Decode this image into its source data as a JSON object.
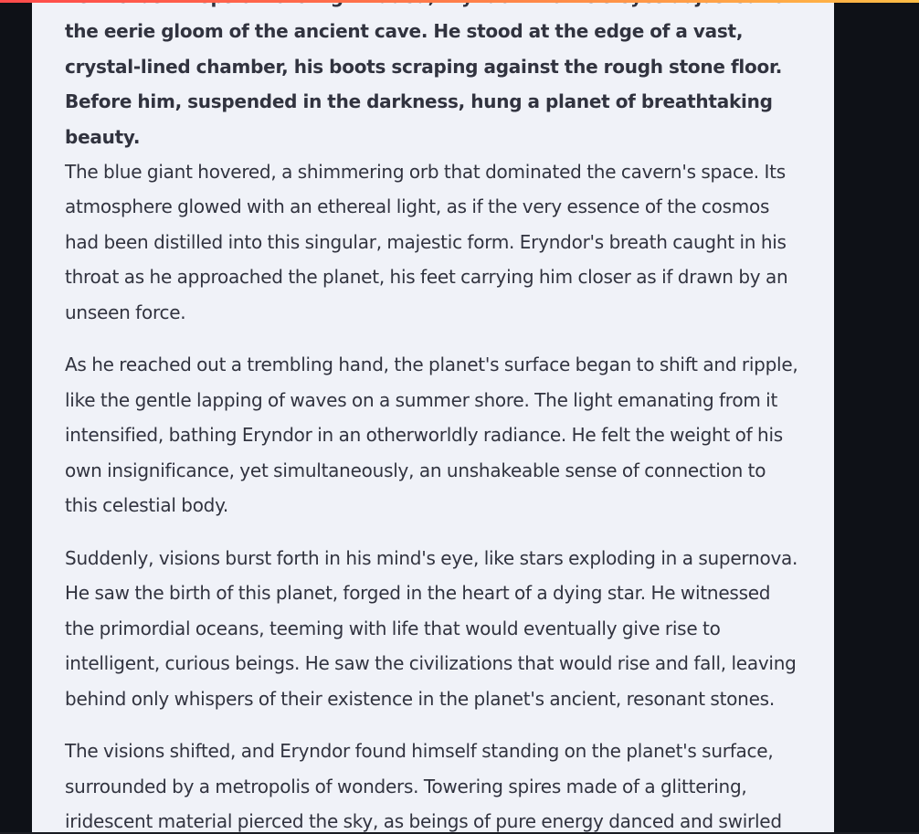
{
  "story": {
    "paragraphs": [
      {
        "style": "bold",
        "text": "As the last wisps of torchlight faded, Eryndor Thorne's eyes adjusted to the eerie gloom of the ancient cave. He stood at the edge of a vast, crystal-lined chamber, his boots scraping against the rough stone floor. Before him, suspended in the darkness, hung a planet of breathtaking beauty."
      },
      {
        "style": "normal",
        "text": "The blue giant hovered, a shimmering orb that dominated the cavern's space. Its atmosphere glowed with an ethereal light, as if the very essence of the cosmos had been distilled into this singular, majestic form. Eryndor's breath caught in his throat as he approached the planet, his feet carrying him closer as if drawn by an unseen force."
      },
      {
        "style": "normal",
        "text": "As he reached out a trembling hand, the planet's surface began to shift and ripple, like the gentle lapping of waves on a summer shore. The light emanating from it intensified, bathing Eryndor in an otherworldly radiance. He felt the weight of his own insignificance, yet simultaneously, an unshakeable sense of connection to this celestial body."
      },
      {
        "style": "normal",
        "text": "Suddenly, visions burst forth in his mind's eye, like stars exploding in a supernova. He saw the birth of this planet, forged in the heart of a dying star. He witnessed the primordial oceans, teeming with life that would eventually give rise to intelligent, curious beings. He saw the civilizations that would rise and fall, leaving behind only whispers of their existence in the planet's ancient, resonant stones."
      },
      {
        "style": "normal",
        "text": "The visions shifted, and Eryndor found himself standing on the planet's surface, surrounded by a metropolis of wonders. Towering spires made of a glittering, iridescent material pierced the sky, as beings of pure energy danced and swirled"
      }
    ]
  },
  "colors": {
    "app_background": "#0e1117",
    "content_background": "#f0f2f8",
    "text": "#31333f",
    "accent_start": "#ff4b4b",
    "accent_end": "#ffbd45"
  }
}
